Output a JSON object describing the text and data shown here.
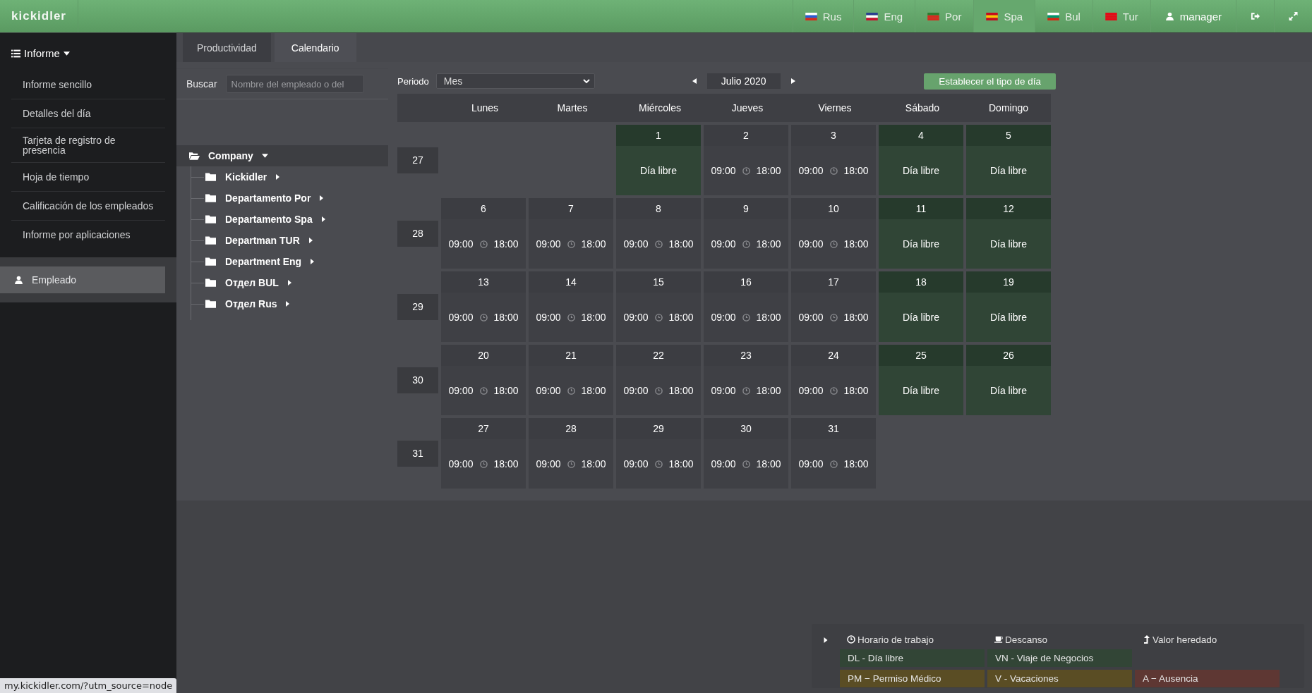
{
  "topbar": {
    "logo": "kickidler",
    "languages": [
      {
        "label": "Rus",
        "selected": false
      },
      {
        "label": "Eng",
        "selected": false
      },
      {
        "label": "Por",
        "selected": false
      },
      {
        "label": "Spa",
        "selected": true
      },
      {
        "label": "Bul",
        "selected": false
      },
      {
        "label": "Tur",
        "selected": false
      }
    ],
    "user": "manager"
  },
  "sidebar": {
    "menu_title": "Informe",
    "items": [
      "Informe sencillo",
      "Detalles del día",
      "Tarjeta de registro de presencia",
      "Hoja de tiempo",
      "Calificación de los empleados",
      "Informe por aplicaciones"
    ],
    "employee": {
      "label": "Empleado",
      "selected": true
    }
  },
  "tabs": [
    {
      "label": "Productividad",
      "selected": false
    },
    {
      "label": "Calendario",
      "selected": true
    }
  ],
  "search": {
    "label": "Buscar",
    "placeholder": "Nombre del empleado o del"
  },
  "tree": {
    "label": "Company",
    "expanded": true,
    "children": [
      {
        "label": "Kickidler",
        "expanded": false
      },
      {
        "label": "Departamento Por",
        "expanded": false
      },
      {
        "label": "Departamento Spa",
        "expanded": false
      },
      {
        "label": "Departman TUR",
        "expanded": false
      },
      {
        "label": "Department Eng",
        "expanded": false
      },
      {
        "label": "Отдел BUL",
        "expanded": false
      },
      {
        "label": "Отдел Rus",
        "expanded": false
      }
    ]
  },
  "calendar": {
    "period_label": "Periodo",
    "period_value": "Mes",
    "month": "Julio 2020",
    "set_day_type_button": "Establecer el tipo de día",
    "weekdays": [
      "Lunes",
      "Martes",
      "Miércoles",
      "Jueves",
      "Viernes",
      "Sábado",
      "Domingo"
    ],
    "weeks": [
      {
        "number": "27",
        "days": [
          {
            "kind": "empty"
          },
          {
            "kind": "empty"
          },
          {
            "kind": "free",
            "day": "1",
            "label": "Día libre"
          },
          {
            "kind": "work",
            "day": "2",
            "start": "09:00",
            "end": "18:00"
          },
          {
            "kind": "work",
            "day": "3",
            "start": "09:00",
            "end": "18:00"
          },
          {
            "kind": "free",
            "day": "4",
            "label": "Día libre"
          },
          {
            "kind": "free",
            "day": "5",
            "label": "Día libre"
          }
        ]
      },
      {
        "number": "28",
        "days": [
          {
            "kind": "work",
            "day": "6",
            "start": "09:00",
            "end": "18:00"
          },
          {
            "kind": "work",
            "day": "7",
            "start": "09:00",
            "end": "18:00"
          },
          {
            "kind": "work",
            "day": "8",
            "start": "09:00",
            "end": "18:00"
          },
          {
            "kind": "work",
            "day": "9",
            "start": "09:00",
            "end": "18:00"
          },
          {
            "kind": "work",
            "day": "10",
            "start": "09:00",
            "end": "18:00"
          },
          {
            "kind": "free",
            "day": "11",
            "label": "Día libre"
          },
          {
            "kind": "free",
            "day": "12",
            "label": "Día libre"
          }
        ]
      },
      {
        "number": "29",
        "days": [
          {
            "kind": "work",
            "day": "13",
            "start": "09:00",
            "end": "18:00"
          },
          {
            "kind": "work",
            "day": "14",
            "start": "09:00",
            "end": "18:00"
          },
          {
            "kind": "work",
            "day": "15",
            "start": "09:00",
            "end": "18:00"
          },
          {
            "kind": "work",
            "day": "16",
            "start": "09:00",
            "end": "18:00"
          },
          {
            "kind": "work",
            "day": "17",
            "start": "09:00",
            "end": "18:00"
          },
          {
            "kind": "free",
            "day": "18",
            "label": "Día libre"
          },
          {
            "kind": "free",
            "day": "19",
            "label": "Día libre"
          }
        ]
      },
      {
        "number": "30",
        "days": [
          {
            "kind": "work",
            "day": "20",
            "start": "09:00",
            "end": "18:00"
          },
          {
            "kind": "work",
            "day": "21",
            "start": "09:00",
            "end": "18:00"
          },
          {
            "kind": "work",
            "day": "22",
            "start": "09:00",
            "end": "18:00"
          },
          {
            "kind": "work",
            "day": "23",
            "start": "09:00",
            "end": "18:00"
          },
          {
            "kind": "work",
            "day": "24",
            "start": "09:00",
            "end": "18:00"
          },
          {
            "kind": "free",
            "day": "25",
            "label": "Día libre"
          },
          {
            "kind": "free",
            "day": "26",
            "label": "Día libre"
          }
        ]
      },
      {
        "number": "31",
        "days": [
          {
            "kind": "work",
            "day": "27",
            "start": "09:00",
            "end": "18:00"
          },
          {
            "kind": "work",
            "day": "28",
            "start": "09:00",
            "end": "18:00"
          },
          {
            "kind": "work",
            "day": "29",
            "start": "09:00",
            "end": "18:00"
          },
          {
            "kind": "work",
            "day": "30",
            "start": "09:00",
            "end": "18:00"
          },
          {
            "kind": "work",
            "day": "31",
            "start": "09:00",
            "end": "18:00"
          },
          {
            "kind": "empty"
          },
          {
            "kind": "empty"
          }
        ]
      }
    ]
  },
  "legend": {
    "expanded": false,
    "headers": [
      {
        "kind": "clock",
        "label": "Horario de trabajo"
      },
      {
        "kind": "cup",
        "label": "Descanso"
      },
      {
        "kind": "inherited",
        "label": "Valor heredado"
      }
    ],
    "rows": [
      [
        {
          "label": "DL - Día libre",
          "color": "#324536"
        },
        {
          "label": "VN - Viaje de Negocios",
          "color": "#324536"
        }
      ],
      [
        {
          "label": "PM − Permiso Médico",
          "color": "#5a4d24"
        },
        {
          "label": "V - Vacaciones",
          "color": "#5a4d24"
        },
        {
          "label": "A − Ausencia",
          "color": "#5e3733"
        }
      ]
    ]
  },
  "status_bar": "my.kickidler.com/?utm_source=node"
}
